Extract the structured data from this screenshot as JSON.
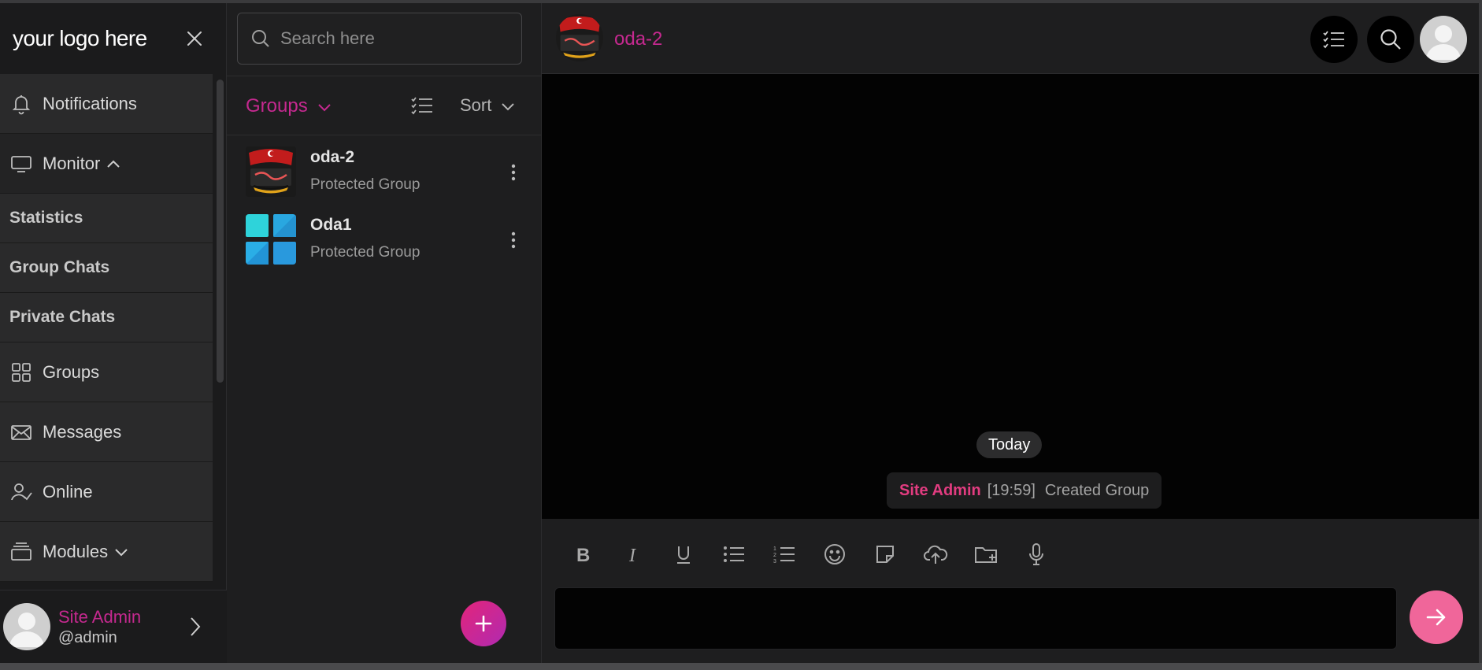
{
  "sidebar": {
    "logo": "your logo here",
    "items": [
      {
        "label": "Notifications",
        "icon": "bell-icon"
      },
      {
        "label": "Monitor",
        "icon": "monitor-icon"
      },
      {
        "label": "Statistics"
      },
      {
        "label": "Group Chats"
      },
      {
        "label": "Private Chats"
      },
      {
        "label": "Groups",
        "icon": "grid-icon"
      },
      {
        "label": "Messages",
        "icon": "envelope-icon"
      },
      {
        "label": "Online",
        "icon": "user-check-icon"
      },
      {
        "label": "Modules",
        "icon": "layers-icon"
      }
    ],
    "user": {
      "name": "Site Admin",
      "handle": "@admin"
    }
  },
  "groups_panel": {
    "search_placeholder": "Search here",
    "title": "Groups",
    "sort_label": "Sort",
    "groups": [
      {
        "name": "oda-2",
        "subtitle": "Protected Group"
      },
      {
        "name": "Oda1",
        "subtitle": "Protected Group"
      }
    ]
  },
  "chat": {
    "title": "oda-2",
    "day_label": "Today",
    "system_message": {
      "user": "Site Admin",
      "time": "[19:59]",
      "text": "Created Group"
    },
    "toolbar": [
      "bold-icon",
      "italic-icon",
      "underline-icon",
      "bullet-list-icon",
      "numbered-list-icon",
      "emoji-icon",
      "sticky-note-icon",
      "cloud-upload-icon",
      "folder-add-icon",
      "microphone-icon"
    ]
  },
  "colors": {
    "accent": "#c5298f",
    "send_button": "#f0669a",
    "background": "#1e1e1f"
  }
}
